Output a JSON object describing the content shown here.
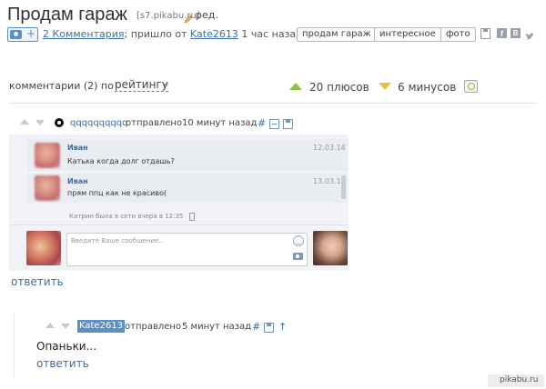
{
  "post": {
    "title": "Продам гараж",
    "source": "[s7.pikabu.ru]",
    "edit_label": "ред.",
    "comments_link": "2 Комментария",
    "from_text": "; пришло от",
    "author": "Kate2613",
    "time_ago": "1 час назад",
    "photo_plus": "+",
    "tags": [
      "продам гараж",
      "интересное",
      "фото"
    ],
    "share_icons": [
      "save-icon",
      "facebook-icon",
      "vk-icon",
      "twitter-icon"
    ]
  },
  "comments_bar": {
    "label": "комментарии (2) по",
    "sort": "рейтингу",
    "plus": "20 плюсов",
    "minus": "6 минусов"
  },
  "comment1": {
    "user": "qqqqqqqqqq",
    "sent": "отправлено",
    "time": "10 минут назад",
    "hash": "#"
  },
  "chat": {
    "messages": [
      {
        "name": "Иван",
        "date": "12.03.14",
        "text": "Катька когда долг отдашь?"
      },
      {
        "name": "Иван",
        "date": "13.03.14",
        "text": "прям ппц как не красиво("
      }
    ],
    "status": "Катрин была в сети вчера в 12:35",
    "input_placeholder": "Введите Ваше сообщение..."
  },
  "reply1": "ответить",
  "comment2": {
    "user": "Kate2613",
    "sent": "отправлено",
    "time": "5 минут назад",
    "hash": "#",
    "text": "Опаньки...",
    "reply": "ответить"
  },
  "watermark": "pikabu.ru",
  "colors": {
    "link": "#3a6ea5",
    "plus": "#8cc43c",
    "minus": "#e8c33a",
    "highlight": "#5b8fc6"
  }
}
